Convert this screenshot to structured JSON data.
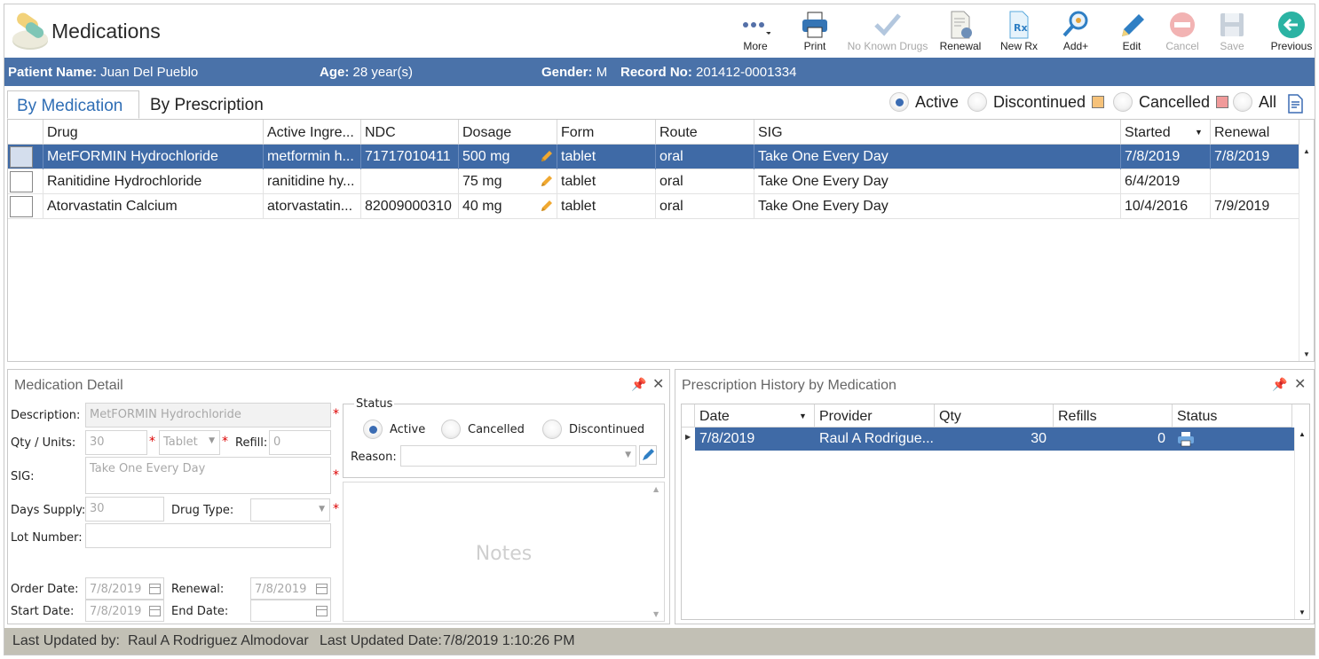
{
  "header": {
    "title": "Medications",
    "toolbar": [
      {
        "label": "More",
        "icon": "more-icon",
        "disabled": false
      },
      {
        "label": "Print",
        "icon": "printer-icon",
        "disabled": false
      },
      {
        "label": "No Known Drugs",
        "icon": "checkmark-icon",
        "disabled": true
      },
      {
        "label": "Renewal",
        "icon": "renewal-icon",
        "disabled": false
      },
      {
        "label": "New Rx",
        "icon": "new-rx-icon",
        "disabled": false
      },
      {
        "label": "Add+",
        "icon": "add-search-icon",
        "disabled": false
      },
      {
        "label": "Edit",
        "icon": "pencil-icon",
        "disabled": false
      },
      {
        "label": "Cancel",
        "icon": "cancel-icon",
        "disabled": true
      },
      {
        "label": "Save",
        "icon": "save-icon",
        "disabled": true
      },
      {
        "label": "Previous",
        "icon": "back-arrow-icon",
        "disabled": false
      }
    ]
  },
  "patient": {
    "name_label": "Patient Name:",
    "name": "Juan Del Pueblo",
    "age_label": "Age:",
    "age": "28 year(s)",
    "gender_label": "Gender:",
    "gender": "M",
    "record_label": "Record No:",
    "record": "201412-0001334"
  },
  "tabs": {
    "by_medication": "By Medication",
    "by_prescription": "By Prescription"
  },
  "filters": {
    "active": "Active",
    "discontinued": "Discontinued",
    "cancelled": "Cancelled",
    "all": "All",
    "selected": "Active",
    "discontinued_color": "#f6c27a",
    "cancelled_color": "#f09a9a"
  },
  "grid": {
    "columns": [
      "Drug",
      "Active Ingre...",
      "NDC",
      "Dosage",
      "Form",
      "Route",
      "SIG",
      "Started",
      "Renewal"
    ],
    "rows": [
      {
        "drug": "MetFORMIN Hydrochloride",
        "ingredient": "metformin h...",
        "ndc": "71717010411",
        "dosage": "500 mg",
        "form": "tablet",
        "route": "oral",
        "sig": "Take One Every Day",
        "started": "7/8/2019",
        "renewal": "7/8/2019",
        "selected": true
      },
      {
        "drug": "Ranitidine Hydrochloride",
        "ingredient": "ranitidine hy...",
        "ndc": "",
        "dosage": "75 mg",
        "form": "tablet",
        "route": "oral",
        "sig": "Take One Every Day",
        "started": "6/4/2019",
        "renewal": "",
        "selected": false
      },
      {
        "drug": "Atorvastatin Calcium",
        "ingredient": "atorvastatin...",
        "ndc": "82009000310",
        "dosage": "40 mg",
        "form": "tablet",
        "route": "oral",
        "sig": "Take One Every Day",
        "started": "10/4/2016",
        "renewal": "7/9/2019",
        "selected": false
      }
    ]
  },
  "detail": {
    "title": "Medication Detail",
    "description_label": "Description:",
    "description": "MetFORMIN Hydrochloride",
    "qty_label": "Qty / Units:",
    "qty": "30",
    "units": "Tablet",
    "refill_label": "Refill:",
    "refill": "0",
    "sig_label": "SIG:",
    "sig": "Take One Every Day",
    "days_label": "Days Supply:",
    "days": "30",
    "drugtype_label": "Drug Type:",
    "drugtype": "",
    "lot_label": "Lot Number:",
    "lot": "",
    "order_label": "Order Date:",
    "order": "7/8/2019",
    "renewal_label": "Renewal:",
    "renewal": "7/8/2019",
    "start_label": "Start Date:",
    "start": "7/8/2019",
    "end_label": "End Date:",
    "end": "",
    "status_legend": "Status",
    "status_active": "Active",
    "status_cancelled": "Cancelled",
    "status_discontinued": "Discontinued",
    "reason_label": "Reason:",
    "reason": "",
    "notes_placeholder": "Notes"
  },
  "history": {
    "title": "Prescription History by Medication",
    "columns": [
      "Date",
      "Provider",
      "Qty",
      "Refills",
      "Status"
    ],
    "rows": [
      {
        "date": "7/8/2019",
        "provider": "Raul A Rodrigue...",
        "qty": "30",
        "refills": "0",
        "status_icon": "printer-icon"
      }
    ]
  },
  "footer": {
    "updated_by_label": "Last Updated by:",
    "updated_by": "Raul A Rodriguez Almodovar",
    "updated_date_label": "Last Updated Date:",
    "updated_date": "7/8/2019 1:10:26 PM"
  }
}
